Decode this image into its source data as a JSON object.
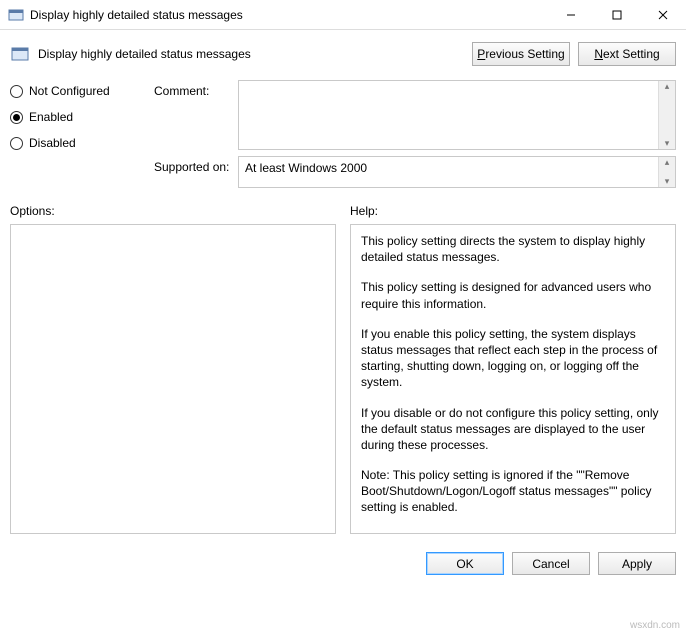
{
  "window": {
    "title": "Display highly detailed status messages"
  },
  "header": {
    "title": "Display highly detailed status messages",
    "prev_label": "Previous Setting",
    "prev_hotkey": "P",
    "next_label": "Next Setting",
    "next_hotkey": "N"
  },
  "radios": {
    "not_configured": "Not Configured",
    "enabled": "Enabled",
    "disabled": "Disabled",
    "selected": "enabled"
  },
  "labels": {
    "comment": "Comment:",
    "supported_on": "Supported on:",
    "options": "Options:",
    "help": "Help:"
  },
  "fields": {
    "comment_value": "",
    "supported_value": "At least Windows 2000"
  },
  "help": {
    "p1": "This policy setting directs the system to display highly detailed status messages.",
    "p2": "This policy setting is designed for advanced users who require this information.",
    "p3": "If you enable this policy setting, the system displays status messages that reflect each step in the process of starting, shutting down, logging on, or logging off the system.",
    "p4": "If you disable or do not configure this policy setting, only the default status messages are displayed to the user during these processes.",
    "p5": "Note: This policy setting is ignored if the \"\"Remove Boot/Shutdown/Logon/Logoff status messages\"\" policy setting is enabled."
  },
  "buttons": {
    "ok": "OK",
    "cancel": "Cancel",
    "apply": "Apply"
  },
  "watermark": "wsxdn.com"
}
